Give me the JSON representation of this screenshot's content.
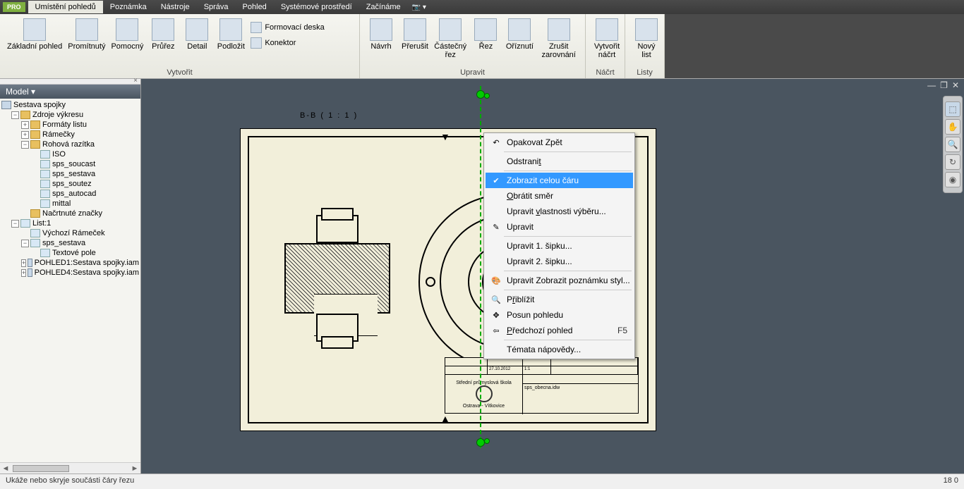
{
  "menubar": {
    "pro": "PRO",
    "tabs": [
      "Umístění pohledů",
      "Poznámka",
      "Nástroje",
      "Správa",
      "Pohled",
      "Systémové prostředí",
      "Začínáme"
    ],
    "activeIndex": 0
  },
  "ribbon": {
    "groups": {
      "create": {
        "label": "Vytvořit",
        "buttons": {
          "base": "Základní pohled",
          "projected": "Promítnutý",
          "auxiliary": "Pomocný",
          "section": "Průřez",
          "detail": "Detail",
          "overlay": "Podložit",
          "formboard": "Formovací deska",
          "connector": "Konektor"
        }
      },
      "edit": {
        "label": "Upravit",
        "buttons": {
          "draft": "Návrh",
          "break": "Přerušit",
          "partial": "Částečný řez",
          "slice": "Řez",
          "crop": "Oříznutí",
          "unalign": "Zrušit zarovnání"
        }
      },
      "sketch": {
        "label": "Náčrt",
        "button": "Vytvořit náčrt",
        "line1": "Vytvořit",
        "line2": "náčrt"
      },
      "sheets": {
        "label": "Listy",
        "button": "Nový list"
      }
    }
  },
  "browser": {
    "title": "Model ▾",
    "root": "Sestava spojky",
    "nodes": {
      "resources": "Zdroje výkresu",
      "formats": "Formáty listu",
      "frames": "Rámečky",
      "titleblocks": "Rohová razítka",
      "iso": "ISO",
      "sps_soucast": "sps_soucast",
      "sps_sestava": "sps_sestava",
      "sps_soutez": "sps_soutez",
      "sps_autocad": "sps_autocad",
      "mittal": "mittal",
      "sketched": "Načrtnuté značky",
      "sheet": "List:1",
      "defframe": "Výchozí Rámeček",
      "sps_sestava2": "sps_sestava",
      "textfield": "Textové pole",
      "view1": "POHLED1:Sestava spojky.iam",
      "view4": "POHLED4:Sestava spojky.iam"
    }
  },
  "canvas": {
    "sectionLabel": "B-B ( 1 : 1 )"
  },
  "titleblock": {
    "school": "Střední průmyslová škola",
    "city": "Ostrava - Vítkovice",
    "file": "sps_obecna.idw",
    "date": "27.10.2012",
    "scale": "1:1"
  },
  "contextMenu": {
    "repeat": "Opakovat Zpět",
    "delete": "Odstranit",
    "showLine": "Zobrazit celou čáru",
    "reverse": "Obrátit směr",
    "editSel": "Upravit vlastnosti výběru...",
    "edit": "Upravit",
    "arrow1": "Upravit 1. šipku...",
    "arrow2": "Upravit 2. šipku...",
    "editStyle": "Upravit Zobrazit poznámku styl...",
    "zoom": "Přiblížit",
    "pan": "Posun pohledu",
    "prevView": "Předchozí pohled",
    "prevViewKey": "F5",
    "help": "Témata nápovědy..."
  },
  "statusbar": {
    "hint": "Ukáže nebo skryje součásti čáry řezu",
    "coords": "18     0"
  },
  "navbar": {
    "home": "⌂"
  }
}
